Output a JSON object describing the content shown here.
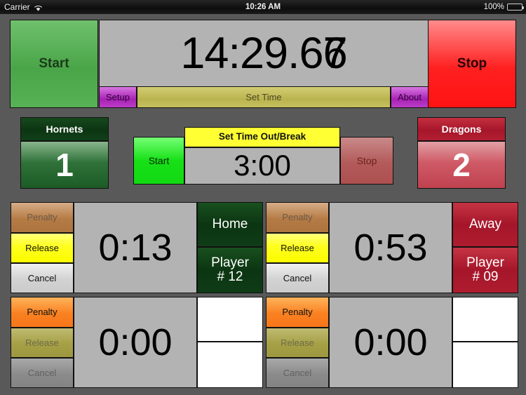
{
  "statusbar": {
    "carrier": "Carrier",
    "wifi_icon": "wifi-icon",
    "time": "10:26 AM",
    "battery_percent": "100%",
    "battery_icon": "battery-icon"
  },
  "main_timer": {
    "start_label": "Start",
    "stop_label": "Stop",
    "display": "14:29.67",
    "display_prefix": "14:29.6",
    "display_glyph_a": "7",
    "display_glyph_b": "6",
    "setup_label": "Setup",
    "set_time_label": "Set Time",
    "about_label": "About"
  },
  "teams": {
    "home": {
      "name": "Hornets",
      "score": "1",
      "color": "#0c3512"
    },
    "away": {
      "name": "Dragons",
      "score": "2",
      "color": "#a6162a"
    }
  },
  "break_timer": {
    "start_label": "Start",
    "title": "Set Time Out/Break",
    "display": "3:00",
    "stop_label": "Stop"
  },
  "penalty_labels": {
    "penalty": "Penalty",
    "release": "Release",
    "cancel": "Cancel"
  },
  "penalties": [
    {
      "side": "left",
      "time": "0:13",
      "team_label": "Home",
      "player_label": "Player",
      "player_number": "# 12",
      "penalty_enabled": false,
      "release_enabled": true,
      "cancel_enabled": true,
      "team_color": "#0c3512"
    },
    {
      "side": "right",
      "time": "0:53",
      "team_label": "Away",
      "player_label": "Player",
      "player_number": "# 09",
      "penalty_enabled": false,
      "release_enabled": true,
      "cancel_enabled": true,
      "team_color": "#a6162a"
    },
    {
      "side": "left",
      "time": "0:00",
      "team_label": "",
      "player_label": "",
      "player_number": "",
      "penalty_enabled": true,
      "release_enabled": false,
      "cancel_enabled": false,
      "team_color": "#ffffff"
    },
    {
      "side": "right",
      "time": "0:00",
      "team_label": "",
      "player_label": "",
      "player_number": "",
      "penalty_enabled": true,
      "release_enabled": false,
      "cancel_enabled": false,
      "team_color": "#ffffff"
    }
  ],
  "colors": {
    "background": "#595959",
    "display_gray": "#b3b3b3",
    "accent_green": "#17e017",
    "accent_yellow": "#ffff33",
    "accent_purple": "#a822b5",
    "accent_olive": "#bab44f"
  }
}
